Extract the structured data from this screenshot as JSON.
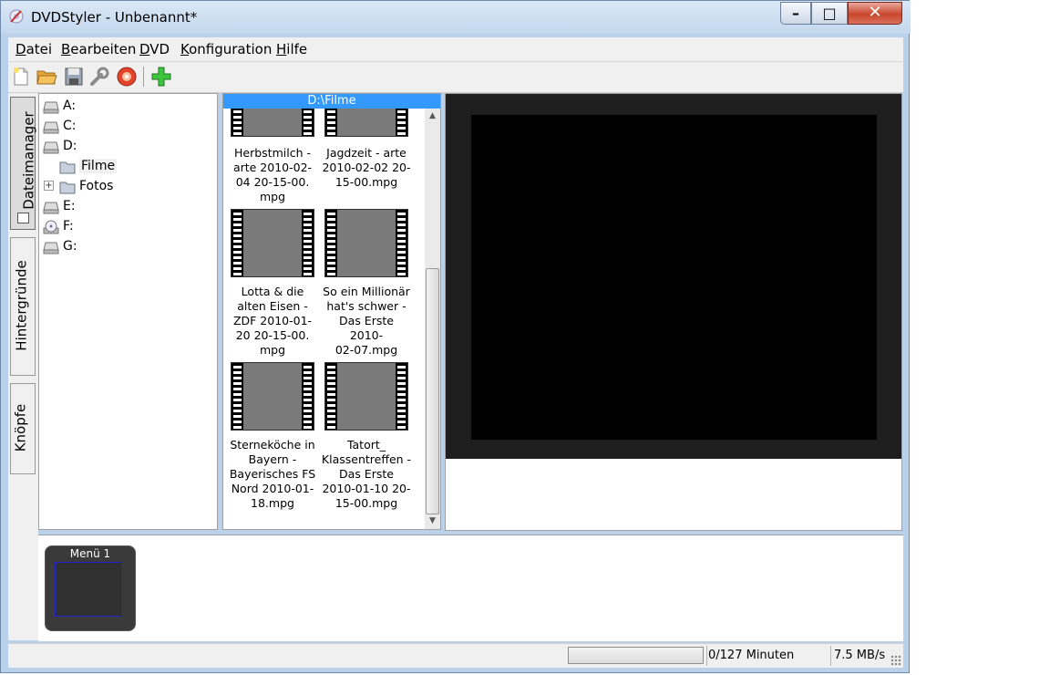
{
  "window": {
    "title": "DVDStyler - Unbenannt*",
    "controls": {
      "minimize": "–",
      "maximize": "□",
      "close": "✕"
    }
  },
  "menubar": [
    "Datei",
    "Bearbeiten",
    "DVD",
    "Konfiguration",
    "Hilfe"
  ],
  "toolbar": {
    "icons": [
      "new-file-icon",
      "open-folder-icon",
      "save-icon",
      "wrench-icon",
      "burn-disc-icon",
      "add-plus-icon"
    ]
  },
  "sidetabs": [
    "Dateimanager",
    "Hintergründe",
    "Knöpfe"
  ],
  "tree": {
    "items": [
      {
        "label": "A:",
        "icon": "drive-icon"
      },
      {
        "label": "C:",
        "icon": "drive-icon"
      },
      {
        "label": "D:",
        "icon": "drive-icon"
      },
      {
        "label": "Filme",
        "icon": "folder-icon"
      },
      {
        "label": "Fotos",
        "icon": "folder-icon",
        "expander": "+"
      },
      {
        "label": "E:",
        "icon": "drive-icon"
      },
      {
        "label": "F:",
        "icon": "cdrom-icon"
      },
      {
        "label": "G:",
        "icon": "drive-icon"
      }
    ]
  },
  "filebrowser": {
    "path": "D:\\Filme",
    "files": [
      {
        "name": "Herbstmilch - arte 2010-02-04 20-15-00.mpg"
      },
      {
        "name": "Jagdzeit - arte 2010-02-02 20-15-00.mpg"
      },
      {
        "name": "Lotta & die alten Eisen - ZDF 2010-01-20 20-15-00.mpg"
      },
      {
        "name": "So ein Millionär hat's schwer - Das Erste 2010-02-07.mpg"
      },
      {
        "name": "Sterneköche in Bayern - Bayerisches FS Nord 2010-01-18.mpg"
      },
      {
        "name": "Tatort_ Klassentreffen - Das Erste 2010-01-10 20-15-00.mpg"
      }
    ],
    "lines": [
      [
        "Herbstmilch -",
        "arte 2010-02-",
        "04 20-15-00.",
        "mpg"
      ],
      [
        "Jagdzeit - arte",
        "2010-02-02 20-",
        "15-00.mpg"
      ],
      [
        "Lotta & die",
        "alten Eisen -",
        "ZDF 2010-01-",
        "20 20-15-00.",
        "mpg"
      ],
      [
        "So ein Millionär",
        "hat's schwer -",
        "Das Erste 2010-",
        "02-07.mpg"
      ],
      [
        "Sterneköche in",
        "Bayern -",
        "Bayerisches FS",
        "Nord 2010-01-",
        "18.mpg"
      ],
      [
        "Tatort_",
        "Klassentreffen -",
        "Das Erste",
        "2010-01-10 20-",
        "15-00.mpg"
      ]
    ]
  },
  "titleset": {
    "menus": [
      {
        "label": "Menü 1"
      }
    ]
  },
  "statusbar": {
    "duration": "0/127 Minuten",
    "rate": "7.5 MB/s"
  }
}
